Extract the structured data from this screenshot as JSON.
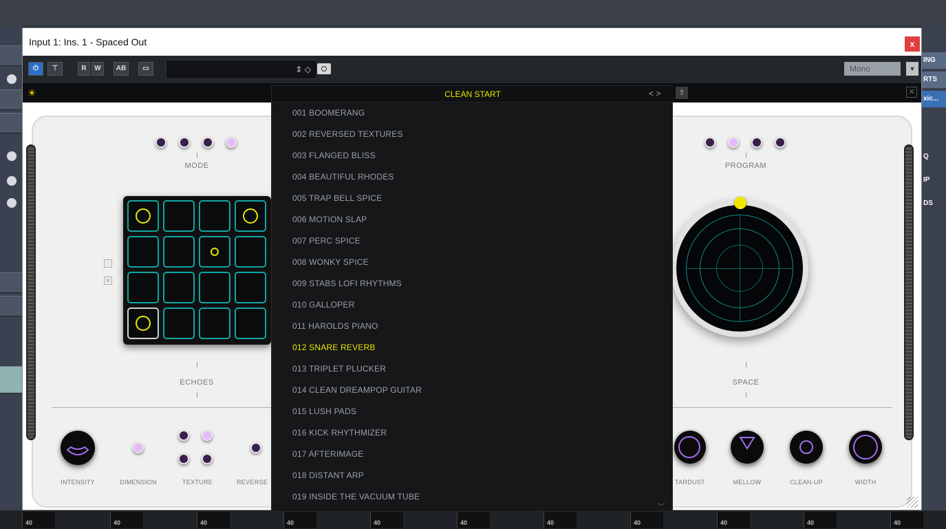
{
  "window": {
    "title": "Input 1: Ins. 1 - Spaced Out",
    "close": "x"
  },
  "toolbar": {
    "power_icon": "power-icon",
    "rw_r": "R",
    "rw_w": "W",
    "compare": "AB",
    "monitor": "▭",
    "preset_arrows": "⇕ ◇",
    "channel_mode": "Mono"
  },
  "plugin_bar": {
    "sun_icon": "sun-icon"
  },
  "preset_menu": {
    "current": "CLEAN START",
    "nav": "< >",
    "items": [
      "001 BOOMERANG",
      "002 REVERSED TEXTURES",
      "003 FLANGED BLISS",
      "004 BEAUTIFUL RHODES",
      "005 TRAP BELL SPICE",
      "006 MOTION SLAP",
      "007 PERC SPICE",
      "008 WONKY SPICE",
      "009 STABS LOFI RHYTHMS",
      "010 GALLOPER",
      "011 HAROLDS PIANO",
      "012 SNARE REVERB",
      "013 TRIPLET PLUCKER",
      "014 CLEAN DREAMPOP GUITAR",
      "015 LUSH PADS",
      "016 KICK RHYTHMIZER",
      "017 AFTERIMAGE",
      "018 DISTANT ARP",
      "019 INSIDE THE VACUUM TUBE"
    ],
    "selected_index": 11
  },
  "echoes": {
    "mode_label": "MODE",
    "section_label": "ECHOES"
  },
  "space": {
    "program_label": "PROGRAM",
    "section_label": "SPACE"
  },
  "bottom_controls": {
    "intensity": "INTENSITY",
    "dimension": "DIMENSION",
    "texture": "TEXTURE",
    "reverse": "REVERSE",
    "stardust": "TARDUST",
    "mellow": "MELLOW",
    "clean_up": "CLEAN-UP",
    "width": "WIDTH"
  },
  "host": {
    "right_buttons": [
      "ING",
      "RTS",
      "xic...",
      "Q",
      "IP",
      "DS"
    ],
    "meter_value": "40"
  },
  "colors": {
    "accent_yellow": "#e8e800",
    "grid_teal": "#0fa6a3",
    "purple": "#a36cf0",
    "power_blue": "#2c6fc9"
  }
}
